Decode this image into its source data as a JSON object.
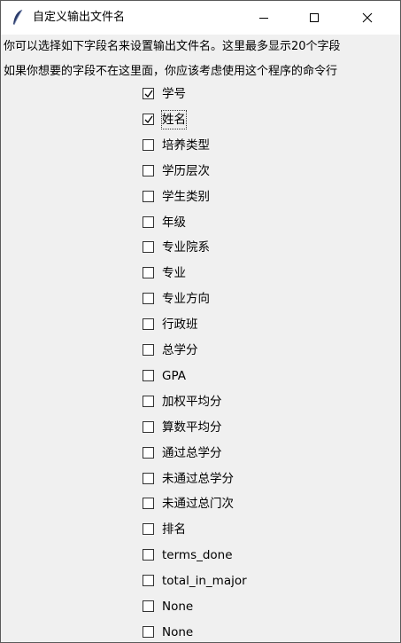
{
  "window": {
    "title": "自定义输出文件名",
    "minimize_icon": "minimize-icon",
    "maximize_icon": "maximize-icon",
    "close_icon": "close-icon",
    "app_icon": "feather-icon"
  },
  "description": {
    "line1": "你可以选择如下字段名来设置输出文件名。这里最多显示20个字段",
    "line2": "如果你想要的字段不在这里面，你应该考虑使用这个程序的命令行"
  },
  "fields": [
    {
      "label": "学号",
      "checked": true
    },
    {
      "label": "姓名",
      "checked": true,
      "focused": true
    },
    {
      "label": "培养类型",
      "checked": false
    },
    {
      "label": "学历层次",
      "checked": false
    },
    {
      "label": "学生类别",
      "checked": false
    },
    {
      "label": "年级",
      "checked": false
    },
    {
      "label": "专业院系",
      "checked": false
    },
    {
      "label": "专业",
      "checked": false
    },
    {
      "label": "专业方向",
      "checked": false
    },
    {
      "label": "行政班",
      "checked": false
    },
    {
      "label": "总学分",
      "checked": false
    },
    {
      "label": "GPA",
      "checked": false
    },
    {
      "label": "加权平均分",
      "checked": false
    },
    {
      "label": "算数平均分",
      "checked": false
    },
    {
      "label": "通过总学分",
      "checked": false
    },
    {
      "label": "未通过总学分",
      "checked": false
    },
    {
      "label": "未通过总门次",
      "checked": false
    },
    {
      "label": "排名",
      "checked": false
    },
    {
      "label": "terms_done",
      "checked": false
    },
    {
      "label": "total_in_major",
      "checked": false
    },
    {
      "label": "None",
      "checked": false
    },
    {
      "label": "None",
      "checked": false
    }
  ]
}
